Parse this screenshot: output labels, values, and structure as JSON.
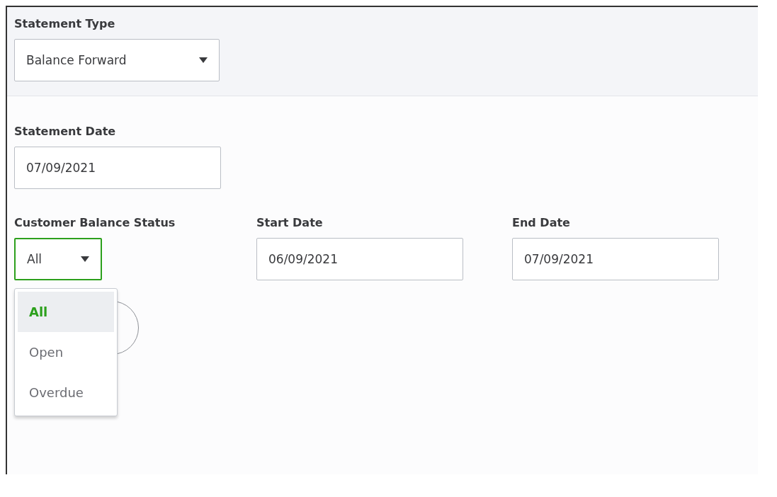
{
  "statement_type": {
    "label": "Statement Type",
    "value": "Balance Forward"
  },
  "statement_date": {
    "label": "Statement Date",
    "value": "07/09/2021"
  },
  "customer_balance_status": {
    "label": "Customer Balance Status",
    "value": "All",
    "focused": true,
    "menu": [
      {
        "label": "All",
        "selected": true
      },
      {
        "label": "Open",
        "selected": false
      },
      {
        "label": "Overdue",
        "selected": false
      }
    ]
  },
  "start_date": {
    "label": "Start Date",
    "value": "06/09/2021"
  },
  "end_date": {
    "label": "End Date",
    "value": "07/09/2021"
  }
}
